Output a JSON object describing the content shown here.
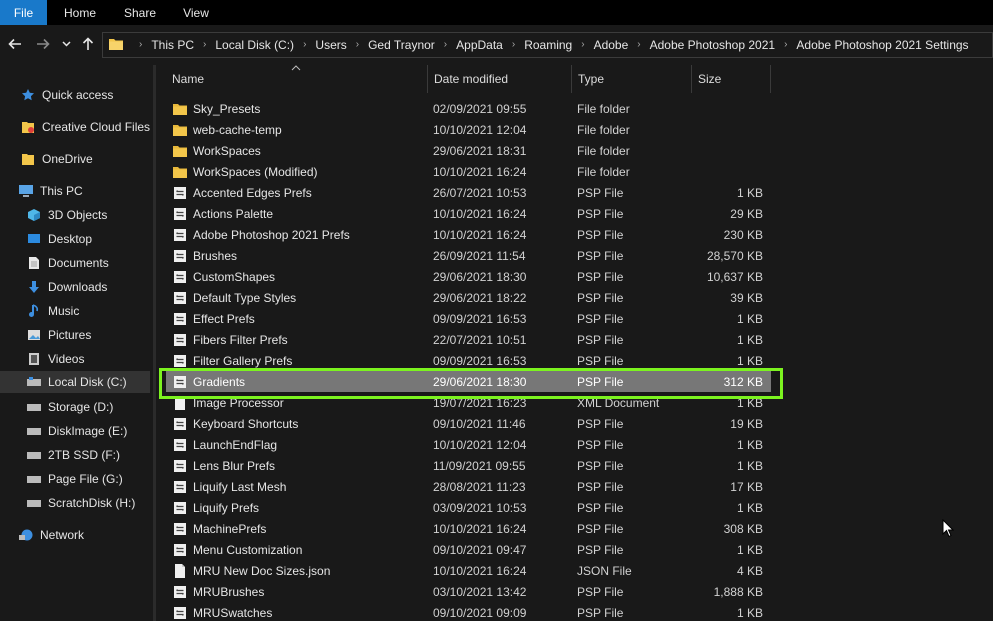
{
  "ribbon": {
    "tabs": [
      "File",
      "Home",
      "Share",
      "View"
    ]
  },
  "nav": {
    "back_icon": "arrow-left-icon",
    "forward_icon": "arrow-right-icon",
    "recent_icon": "chevron-down-icon",
    "up_icon": "arrow-up-icon"
  },
  "address": {
    "crumbs": [
      "This PC",
      "Local Disk (C:)",
      "Users",
      "Ged Traynor",
      "AppData",
      "Roaming",
      "Adobe",
      "Adobe Photoshop 2021",
      "Adobe Photoshop 2021 Settings"
    ]
  },
  "sidebar": {
    "items": [
      {
        "label": "Quick access",
        "icon": "star-icon"
      },
      {
        "label": "Creative Cloud Files",
        "icon": "creative-cloud-icon"
      },
      {
        "label": "OneDrive",
        "icon": "folder-icon"
      },
      {
        "label": "This PC",
        "icon": "computer-icon"
      },
      {
        "label": "3D Objects",
        "icon": "cube-icon"
      },
      {
        "label": "Desktop",
        "icon": "desktop-icon"
      },
      {
        "label": "Documents",
        "icon": "document-icon"
      },
      {
        "label": "Downloads",
        "icon": "download-icon"
      },
      {
        "label": "Music",
        "icon": "music-icon"
      },
      {
        "label": "Pictures",
        "icon": "pictures-icon"
      },
      {
        "label": "Videos",
        "icon": "videos-icon"
      },
      {
        "label": "Local Disk (C:)",
        "icon": "drive-icon"
      },
      {
        "label": "Storage (D:)",
        "icon": "drive-icon"
      },
      {
        "label": "DiskImage (E:)",
        "icon": "drive-icon"
      },
      {
        "label": "2TB SSD (F:)",
        "icon": "drive-icon"
      },
      {
        "label": "Page File (G:)",
        "icon": "drive-icon"
      },
      {
        "label": "ScratchDisk (H:)",
        "icon": "drive-icon"
      },
      {
        "label": "Network",
        "icon": "network-icon"
      }
    ]
  },
  "table": {
    "headers": {
      "name": "Name",
      "date": "Date modified",
      "type": "Type",
      "size": "Size"
    },
    "rows": [
      {
        "name": "Sky_Presets",
        "date": "02/09/2021 09:55",
        "type": "File folder",
        "size": "",
        "icon": "folder-icon"
      },
      {
        "name": "web-cache-temp",
        "date": "10/10/2021 12:04",
        "type": "File folder",
        "size": "",
        "icon": "folder-icon"
      },
      {
        "name": "WorkSpaces",
        "date": "29/06/2021 18:31",
        "type": "File folder",
        "size": "",
        "icon": "folder-icon"
      },
      {
        "name": "WorkSpaces (Modified)",
        "date": "10/10/2021 16:24",
        "type": "File folder",
        "size": "",
        "icon": "folder-icon"
      },
      {
        "name": "Accented Edges Prefs",
        "date": "26/07/2021 10:53",
        "type": "PSP File",
        "size": "1 KB",
        "icon": "psp-file-icon"
      },
      {
        "name": "Actions Palette",
        "date": "10/10/2021 16:24",
        "type": "PSP File",
        "size": "29 KB",
        "icon": "psp-file-icon"
      },
      {
        "name": "Adobe Photoshop 2021 Prefs",
        "date": "10/10/2021 16:24",
        "type": "PSP File",
        "size": "230 KB",
        "icon": "psp-file-icon"
      },
      {
        "name": "Brushes",
        "date": "26/09/2021 11:54",
        "type": "PSP File",
        "size": "28,570 KB",
        "icon": "psp-file-icon"
      },
      {
        "name": "CustomShapes",
        "date": "29/06/2021 18:30",
        "type": "PSP File",
        "size": "10,637 KB",
        "icon": "psp-file-icon"
      },
      {
        "name": "Default Type Styles",
        "date": "29/06/2021 18:22",
        "type": "PSP File",
        "size": "39 KB",
        "icon": "psp-file-icon"
      },
      {
        "name": "Effect Prefs",
        "date": "09/09/2021 16:53",
        "type": "PSP File",
        "size": "1 KB",
        "icon": "psp-file-icon"
      },
      {
        "name": "Fibers Filter Prefs",
        "date": "22/07/2021 10:51",
        "type": "PSP File",
        "size": "1 KB",
        "icon": "psp-file-icon"
      },
      {
        "name": "Filter Gallery Prefs",
        "date": "09/09/2021 16:53",
        "type": "PSP File",
        "size": "1 KB",
        "icon": "psp-file-icon"
      },
      {
        "name": "Gradients",
        "date": "29/06/2021 18:30",
        "type": "PSP File",
        "size": "312 KB",
        "icon": "psp-file-icon",
        "selected": true
      },
      {
        "name": "Image Processor",
        "date": "19/07/2021 16:23",
        "type": "XML Document",
        "size": "1 KB",
        "icon": "document-icon"
      },
      {
        "name": "Keyboard Shortcuts",
        "date": "09/10/2021 11:46",
        "type": "PSP File",
        "size": "19 KB",
        "icon": "psp-file-icon"
      },
      {
        "name": "LaunchEndFlag",
        "date": "10/10/2021 12:04",
        "type": "PSP File",
        "size": "1 KB",
        "icon": "psp-file-icon"
      },
      {
        "name": "Lens Blur Prefs",
        "date": "11/09/2021 09:55",
        "type": "PSP File",
        "size": "1 KB",
        "icon": "psp-file-icon"
      },
      {
        "name": "Liquify Last Mesh",
        "date": "28/08/2021 11:23",
        "type": "PSP File",
        "size": "17 KB",
        "icon": "psp-file-icon"
      },
      {
        "name": "Liquify Prefs",
        "date": "03/09/2021 10:53",
        "type": "PSP File",
        "size": "1 KB",
        "icon": "psp-file-icon"
      },
      {
        "name": "MachinePrefs",
        "date": "10/10/2021 16:24",
        "type": "PSP File",
        "size": "308 KB",
        "icon": "psp-file-icon"
      },
      {
        "name": "Menu Customization",
        "date": "09/10/2021 09:47",
        "type": "PSP File",
        "size": "1 KB",
        "icon": "psp-file-icon"
      },
      {
        "name": "MRU New Doc Sizes.json",
        "date": "10/10/2021 16:24",
        "type": "JSON File",
        "size": "4 KB",
        "icon": "document-icon"
      },
      {
        "name": "MRUBrushes",
        "date": "03/10/2021 13:42",
        "type": "PSP File",
        "size": "1,888 KB",
        "icon": "psp-file-icon"
      },
      {
        "name": "MRUSwatches",
        "date": "09/10/2021 09:09",
        "type": "PSP File",
        "size": "1 KB",
        "icon": "psp-file-icon"
      }
    ]
  },
  "colors": {
    "file_tab": "#1979ca",
    "selection": "#777777",
    "highlight_box": "#7cf31f",
    "folder": "#f3c64a"
  }
}
